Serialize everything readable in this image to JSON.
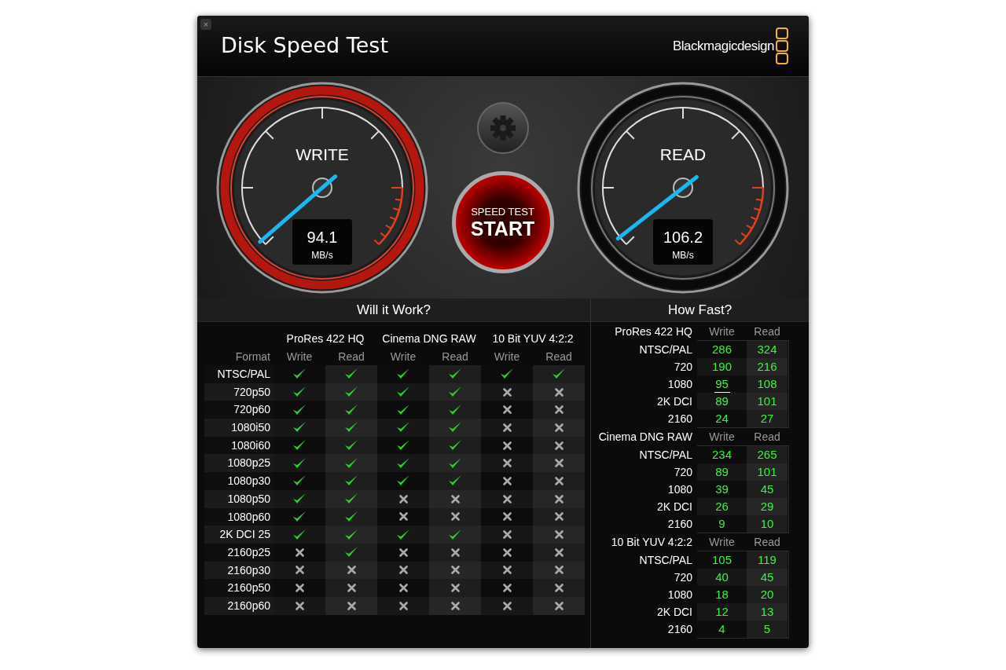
{
  "window": {
    "title": "Disk Speed Test",
    "close": "×",
    "brand": "Blackmagicdesign"
  },
  "gauges": [
    {
      "label": "WRITE",
      "value": "94.1",
      "unit": "MB/s",
      "active": true
    },
    {
      "label": "READ",
      "value": "106.2",
      "unit": "MB/s",
      "active": false
    }
  ],
  "start_button": {
    "caption": "SPEED TEST",
    "label": "START"
  },
  "will_it_work": {
    "title": "Will it Work?",
    "format_heading": "Format",
    "groups": [
      {
        "title": "ProRes 422 HQ",
        "columns": [
          "Write",
          "Read"
        ]
      },
      {
        "title": "Cinema DNG RAW",
        "columns": [
          "Write",
          "Read"
        ]
      },
      {
        "title": "10 Bit YUV 4:2:2",
        "columns": [
          "Write",
          "Read"
        ]
      }
    ],
    "rows": [
      {
        "format": "NTSC/PAL",
        "cells": [
          true,
          true,
          true,
          true,
          true,
          true
        ]
      },
      {
        "format": "720p50",
        "cells": [
          true,
          true,
          true,
          true,
          false,
          false
        ]
      },
      {
        "format": "720p60",
        "cells": [
          true,
          true,
          true,
          true,
          false,
          false
        ]
      },
      {
        "format": "1080i50",
        "cells": [
          true,
          true,
          true,
          true,
          false,
          false
        ]
      },
      {
        "format": "1080i60",
        "cells": [
          true,
          true,
          true,
          true,
          false,
          false
        ]
      },
      {
        "format": "1080p25",
        "cells": [
          true,
          true,
          true,
          true,
          false,
          false
        ]
      },
      {
        "format": "1080p30",
        "cells": [
          true,
          true,
          true,
          true,
          false,
          false
        ]
      },
      {
        "format": "1080p50",
        "cells": [
          true,
          true,
          false,
          false,
          false,
          false
        ]
      },
      {
        "format": "1080p60",
        "cells": [
          true,
          true,
          false,
          false,
          false,
          false
        ]
      },
      {
        "format": "2K DCI 25",
        "cells": [
          true,
          true,
          true,
          true,
          false,
          false
        ]
      },
      {
        "format": "2160p25",
        "cells": [
          false,
          true,
          false,
          false,
          false,
          false
        ]
      },
      {
        "format": "2160p30",
        "cells": [
          false,
          false,
          false,
          false,
          false,
          false
        ]
      },
      {
        "format": "2160p50",
        "cells": [
          false,
          false,
          false,
          false,
          false,
          false
        ]
      },
      {
        "format": "2160p60",
        "cells": [
          false,
          false,
          false,
          false,
          false,
          false
        ]
      }
    ]
  },
  "how_fast": {
    "title": "How Fast?",
    "sections": [
      {
        "title": "ProRes 422 HQ",
        "columns": [
          "Write",
          "Read"
        ],
        "rows": [
          {
            "label": "NTSC/PAL",
            "write": "286",
            "read": "324",
            "limit_line_below": false
          },
          {
            "label": "720",
            "write": "190",
            "read": "216",
            "limit_line_below": false
          },
          {
            "label": "1080",
            "write": "95",
            "read": "108",
            "limit_line_below": true
          },
          {
            "label": "2K DCI",
            "write": "89",
            "read": "101",
            "limit_line_below": false
          },
          {
            "label": "2160",
            "write": "24",
            "read": "27",
            "limit_line_below": false
          }
        ]
      },
      {
        "title": "Cinema DNG RAW",
        "columns": [
          "Write",
          "Read"
        ],
        "rows": [
          {
            "label": "NTSC/PAL",
            "write": "234",
            "read": "265",
            "limit_line_below": false
          },
          {
            "label": "720",
            "write": "89",
            "read": "101",
            "limit_line_below": false
          },
          {
            "label": "1080",
            "write": "39",
            "read": "45",
            "limit_line_below": false
          },
          {
            "label": "2K DCI",
            "write": "26",
            "read": "29",
            "limit_line_below": false
          },
          {
            "label": "2160",
            "write": "9",
            "read": "10",
            "limit_line_below": false
          }
        ]
      },
      {
        "title": "10 Bit YUV 4:2:2",
        "columns": [
          "Write",
          "Read"
        ],
        "rows": [
          {
            "label": "NTSC/PAL",
            "write": "105",
            "read": "119",
            "limit_line_below": false
          },
          {
            "label": "720",
            "write": "40",
            "read": "45",
            "limit_line_below": false
          },
          {
            "label": "1080",
            "write": "18",
            "read": "20",
            "limit_line_below": false
          },
          {
            "label": "2K DCI",
            "write": "12",
            "read": "13",
            "limit_line_below": false
          },
          {
            "label": "2160",
            "write": "4",
            "read": "5",
            "limit_line_below": false
          }
        ]
      }
    ]
  }
}
